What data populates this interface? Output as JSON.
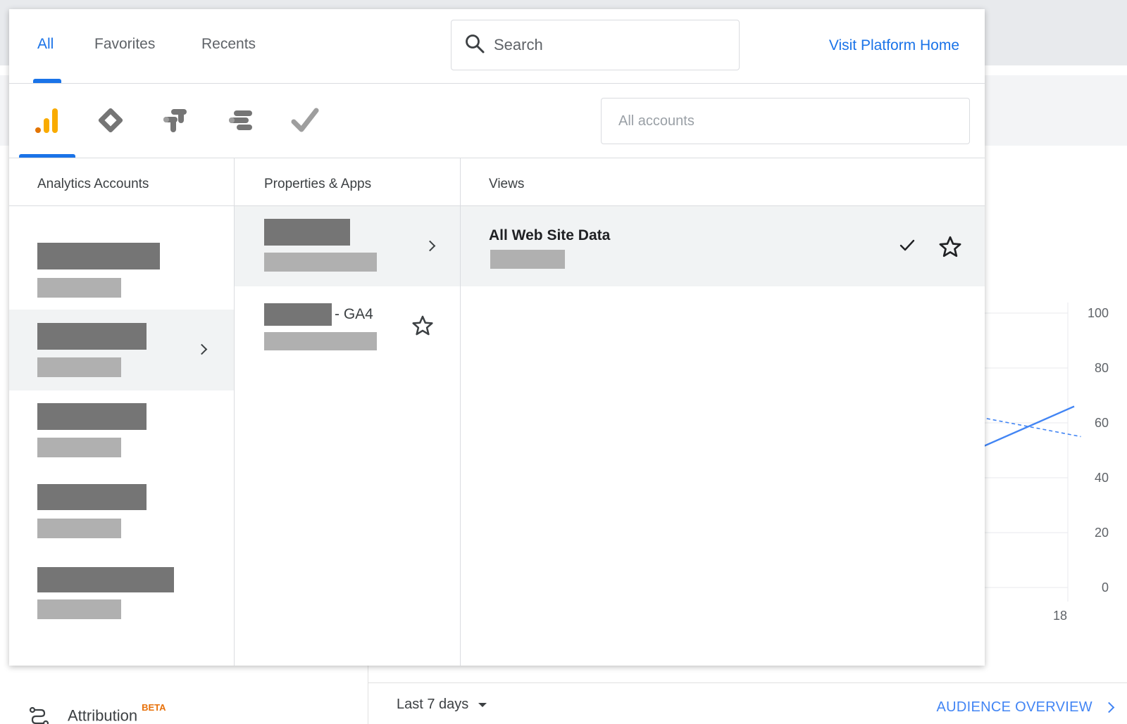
{
  "popup": {
    "tabs": [
      {
        "label": "All",
        "active": true
      },
      {
        "label": "Favorites",
        "active": false
      },
      {
        "label": "Recents",
        "active": false
      }
    ],
    "search": {
      "placeholder": "Search"
    },
    "visit_link": "Visit Platform Home",
    "products": [
      {
        "name": "analytics-icon",
        "active": true
      },
      {
        "name": "tag-manager-icon",
        "active": false
      },
      {
        "name": "data-studio-icon",
        "active": false
      },
      {
        "name": "optimize-icon",
        "active": false
      },
      {
        "name": "surveys-icon",
        "active": false
      }
    ],
    "accounts_filter": {
      "placeholder": "All accounts"
    },
    "columns": {
      "accounts": {
        "header": "Analytics Accounts",
        "selected_index": 1
      },
      "properties": {
        "header": "Properties & Apps"
      },
      "views": {
        "header": "Views"
      }
    },
    "properties": [
      {
        "suffix": "",
        "selected": true
      },
      {
        "suffix": "- GA4",
        "selected": false
      }
    ],
    "views": [
      {
        "name": "All Web Site Data",
        "selected": true
      }
    ]
  },
  "background": {
    "attribution_label": "Attribution",
    "attribution_badge": "BETA",
    "date_range": "Last 7 days",
    "audience_link": "AUDIENCE OVERVIEW",
    "chart_data": {
      "type": "line",
      "y_ticks": [
        "100",
        "80",
        "60",
        "40",
        "20",
        "0"
      ],
      "x_ticks": [
        "18"
      ],
      "ylim": [
        0,
        100
      ],
      "grid": true,
      "series": [
        {
          "style": "solid",
          "color": "#4285f4",
          "values": [
            [
              16.8,
              51
            ],
            [
              18.2,
              66
            ]
          ]
        },
        {
          "style": "dashed",
          "color": "#4285f4",
          "values": [
            [
              16.8,
              62
            ],
            [
              18.3,
              55
            ]
          ]
        }
      ]
    }
  },
  "colors": {
    "accent": "#1a73e8",
    "redaction_dark": "#757575",
    "redaction_light": "#b0b0b0"
  }
}
